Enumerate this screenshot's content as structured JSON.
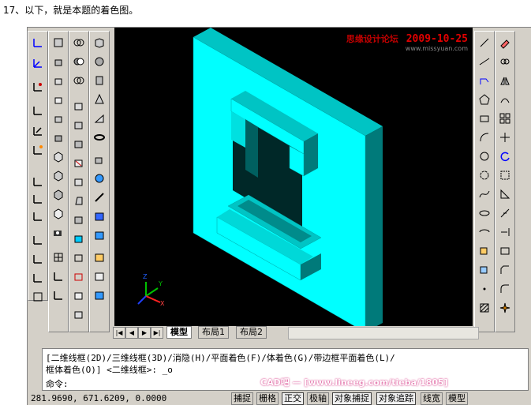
{
  "caption": "17、以下，就是本题的着色图。",
  "viewport": {
    "watermark_site": "思缘设计论坛",
    "watermark_date": "2009-10-25",
    "watermark_url": "www.missyuan.com",
    "ucs": {
      "z": "Z",
      "y": "Y",
      "x": "X"
    }
  },
  "tabs": {
    "model": "模型",
    "layout1": "布局1",
    "layout2": "布局2"
  },
  "command": {
    "line1": "[二维线框(2D)/三维线框(3D)/消隐(H)/平面着色(F)/体着色(G)/带边框平面着色(L)/",
    "line2": "框体着色(O)] <二维线框>: _o",
    "prompt": "命令:"
  },
  "status": {
    "coords": "281.9690, 671.6209, 0.0000",
    "snap": "捕捉",
    "grid": "栅格",
    "ortho": "正交",
    "polar": "极轴",
    "osnap": "对象捕捉",
    "otrack": "对象追踪",
    "lwt": "线宽",
    "model": "模型"
  },
  "footer": "CAD吧 — [www.lineeg.com/tieba/1805]",
  "colors": {
    "cyan": "#00ffff",
    "cyan_dark": "#008b8b",
    "cyan_mid": "#00c4c4"
  }
}
